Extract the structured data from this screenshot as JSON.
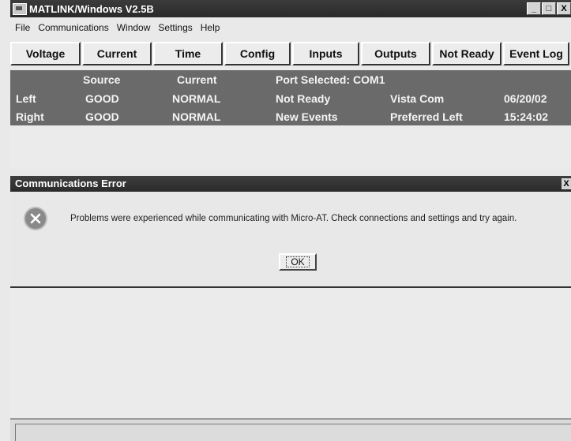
{
  "window": {
    "title": "MATLINK/Windows V2.5B",
    "minimize": "_",
    "maximize": "□",
    "close": "X"
  },
  "menu": [
    {
      "label": "File"
    },
    {
      "label": "Communications"
    },
    {
      "label": "Window"
    },
    {
      "label": "Settings"
    },
    {
      "label": "Help"
    }
  ],
  "toolbar": [
    {
      "label": "Voltage"
    },
    {
      "label": "Current"
    },
    {
      "label": "Time"
    },
    {
      "label": "Config"
    },
    {
      "label": "Inputs"
    },
    {
      "label": "Outputs"
    },
    {
      "label": "Not Ready"
    },
    {
      "label": "Event Log"
    }
  ],
  "status": {
    "col_source": "Source",
    "col_current": "Current",
    "port": "Port Selected: COM1",
    "left_label": "Left",
    "left_source": "GOOD",
    "left_current": "NORMAL",
    "left_state": "Not Ready",
    "left_vista": "Vista Com",
    "date": "06/20/02",
    "right_label": "Right",
    "right_source": "GOOD",
    "right_current": "NORMAL",
    "right_events": "New Events",
    "right_preferred": "Preferred Left",
    "time": "15:24:02"
  },
  "dialog": {
    "title": "Communications Error",
    "close": "X",
    "message": "Problems were experienced while communicating with Micro-AT.  Check connections and settings and try again.",
    "ok": "OK",
    "icon": "error-icon"
  }
}
